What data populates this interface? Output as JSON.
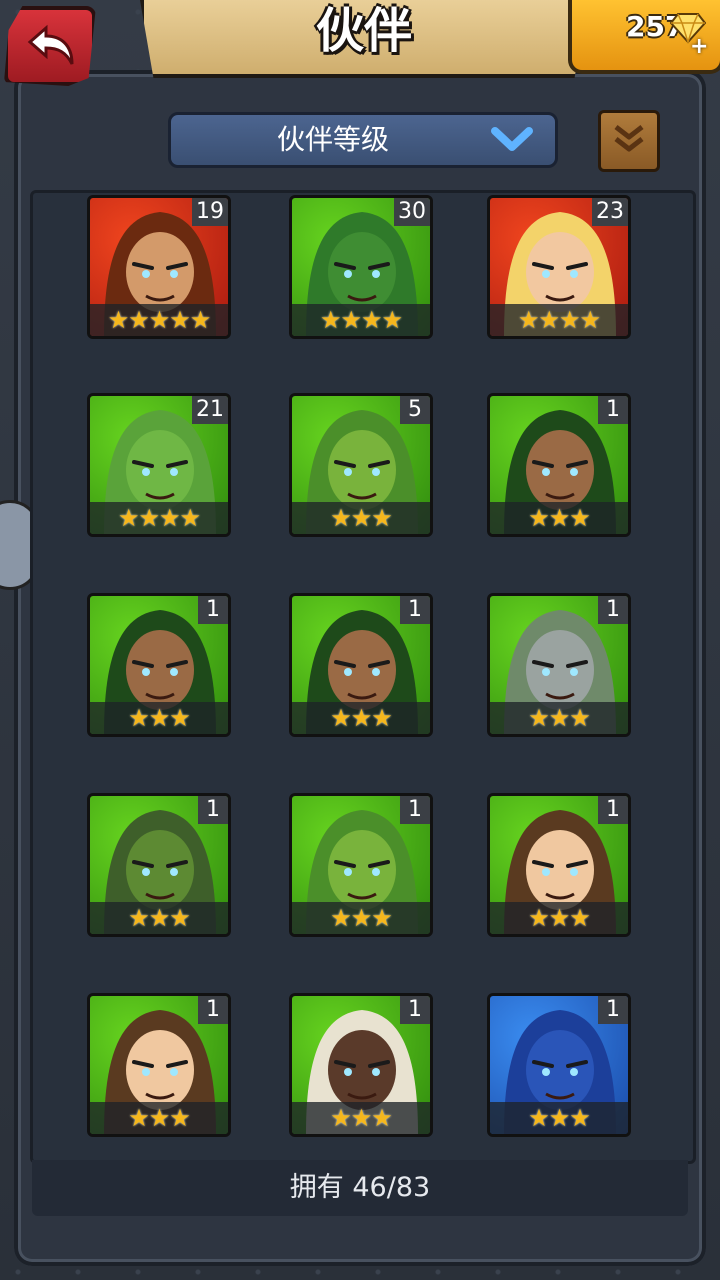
{
  "header": {
    "title": "伙伴"
  },
  "currency": {
    "gems": "257",
    "plus": "+"
  },
  "sort": {
    "label": "伙伴等级"
  },
  "footer": {
    "owned": "拥有 46/83"
  },
  "colors": {
    "red_bg": "#d9331e",
    "green_bg": "#3fae12",
    "blue_bg": "#1f6fd0",
    "star": "#f5b71d"
  },
  "companions": [
    {
      "level": "19",
      "stars": "★★★★★",
      "bg": "red",
      "hair": "#6b2a10",
      "skin": "#d39a6a"
    },
    {
      "level": "30",
      "stars": "★★★★",
      "bg": "green",
      "hair": "#2f7a2a",
      "skin": "#3f8d33"
    },
    {
      "level": "23",
      "stars": "★★★★",
      "bg": "red",
      "hair": "#f3d36a",
      "skin": "#f2c8a0"
    },
    {
      "level": "21",
      "stars": "★★★★",
      "bg": "green",
      "hair": "#5aa33a",
      "skin": "#6fb745"
    },
    {
      "level": "5",
      "stars": "★★★",
      "bg": "green",
      "hair": "#4b8f2a",
      "skin": "#79b33c"
    },
    {
      "level": "1",
      "stars": "★★★",
      "bg": "green",
      "hair": "#1e4a1a",
      "skin": "#9a6a45"
    },
    {
      "level": "1",
      "stars": "★★★",
      "bg": "green",
      "hair": "#1e4a1a",
      "skin": "#9a6a45"
    },
    {
      "level": "1",
      "stars": "★★★",
      "bg": "green",
      "hair": "#1e4a1a",
      "skin": "#9a6a45"
    },
    {
      "level": "1",
      "stars": "★★★",
      "bg": "green",
      "hair": "#6f8a6a",
      "skin": "#9aa3a0"
    },
    {
      "level": "1",
      "stars": "★★★",
      "bg": "green",
      "hair": "#3e5f2a",
      "skin": "#5d8a33"
    },
    {
      "level": "1",
      "stars": "★★★",
      "bg": "green",
      "hair": "#4b8f2a",
      "skin": "#79b33c"
    },
    {
      "level": "1",
      "stars": "★★★",
      "bg": "green",
      "hair": "#5a3a20",
      "skin": "#f0c8a0"
    },
    {
      "level": "1",
      "stars": "★★★",
      "bg": "green",
      "hair": "#5a3a20",
      "skin": "#f0c8a0"
    },
    {
      "level": "1",
      "stars": "★★★",
      "bg": "green",
      "hair": "#e8e2d0",
      "skin": "#5a3a2a"
    },
    {
      "level": "1",
      "stars": "★★★",
      "bg": "blue",
      "hair": "#1c3f9a",
      "skin": "#2a55b8"
    }
  ]
}
